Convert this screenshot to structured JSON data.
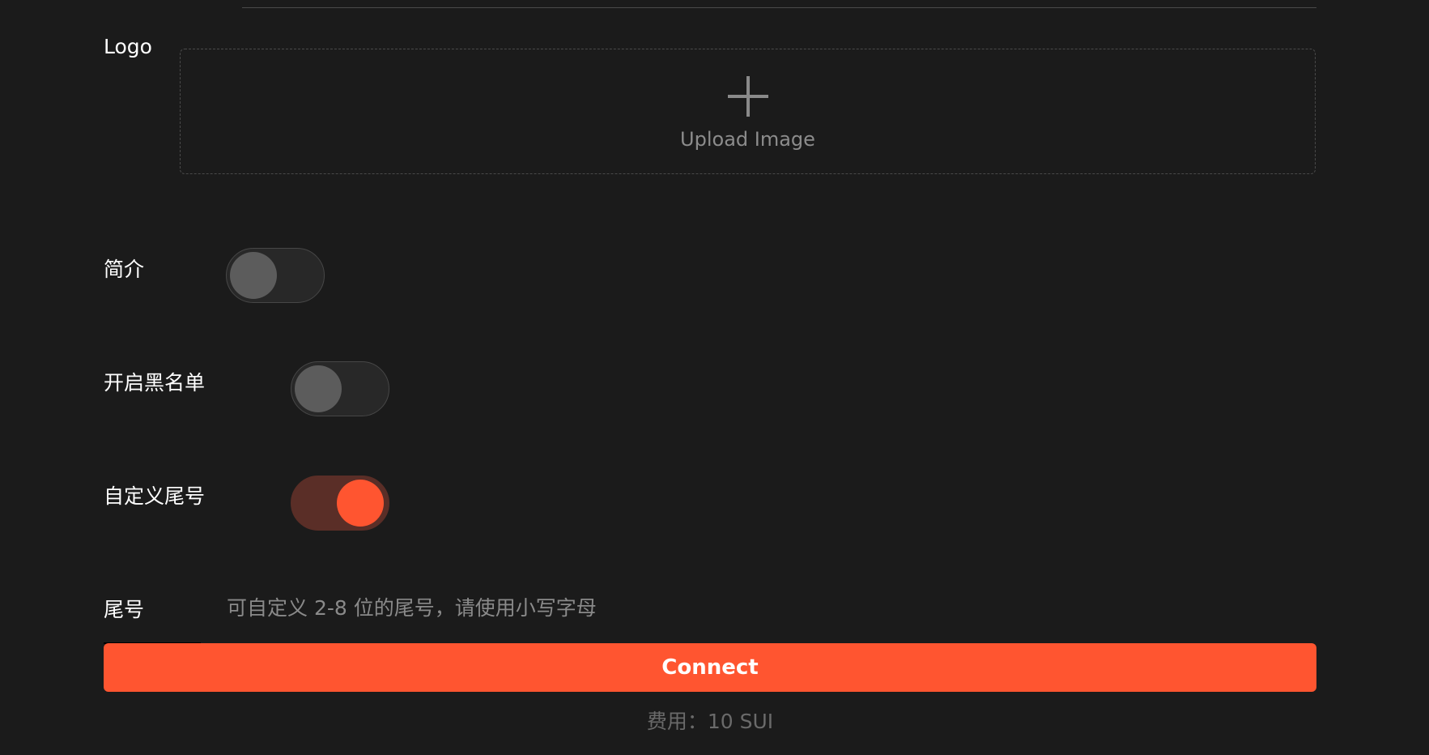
{
  "form": {
    "logo_label": "Logo",
    "upload": {
      "icon": "plus-icon",
      "text": "Upload Image"
    },
    "intro": {
      "label": "简介",
      "enabled": false
    },
    "blacklist": {
      "label": "开启黑名单",
      "enabled": false
    },
    "custom_tail": {
      "label": "自定义尾号",
      "enabled": true
    },
    "tail": {
      "label": "尾号",
      "value": "",
      "placeholder": "可自定义 2-8 位的尾号，请使用小写字母"
    },
    "connect_label": "Connect",
    "fee_text": "费用：10 SUI"
  },
  "colors": {
    "background": "#1b1b1b",
    "accent": "#ff5530",
    "toggle_on_track": "#5a2e27",
    "toggle_off_knob": "#5c5c5c"
  }
}
